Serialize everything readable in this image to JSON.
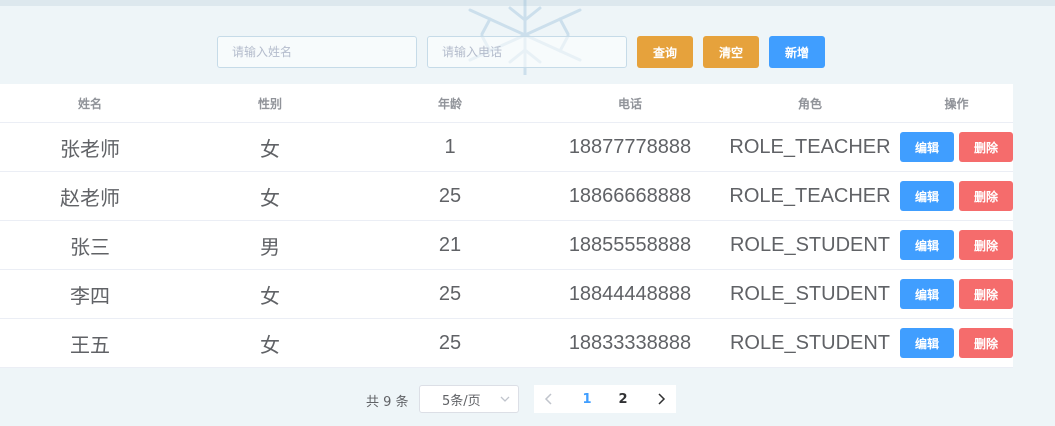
{
  "search": {
    "name_placeholder": "请输入姓名",
    "phone_placeholder": "请输入电话",
    "query_label": "查询",
    "clear_label": "清空",
    "add_label": "新增"
  },
  "table": {
    "headers": [
      "姓名",
      "性别",
      "年龄",
      "电话",
      "角色",
      "操作"
    ],
    "edit_label": "编辑",
    "delete_label": "删除",
    "rows": [
      {
        "name": "张老师",
        "gender": "女",
        "age": "1",
        "phone": "18877778888",
        "role": "ROLE_TEACHER"
      },
      {
        "name": "赵老师",
        "gender": "女",
        "age": "25",
        "phone": "18866668888",
        "role": "ROLE_TEACHER"
      },
      {
        "name": "张三",
        "gender": "男",
        "age": "21",
        "phone": "18855558888",
        "role": "ROLE_STUDENT"
      },
      {
        "name": "李四",
        "gender": "女",
        "age": "25",
        "phone": "18844448888",
        "role": "ROLE_STUDENT"
      },
      {
        "name": "王五",
        "gender": "女",
        "age": "25",
        "phone": "18833338888",
        "role": "ROLE_STUDENT"
      }
    ]
  },
  "pagination": {
    "total_text": "共 9 条",
    "page_size": "5条/页",
    "pages": [
      "1",
      "2"
    ],
    "current_page": "1"
  },
  "icons": {
    "prev": "chevron-left-icon",
    "next": "chevron-right-icon",
    "select": "chevron-down-icon",
    "background": "snowflake-icon"
  },
  "colors": {
    "primary": "#409eff",
    "warning": "#e6a23c",
    "danger": "#f56c6c",
    "background": "#eef5f8"
  }
}
